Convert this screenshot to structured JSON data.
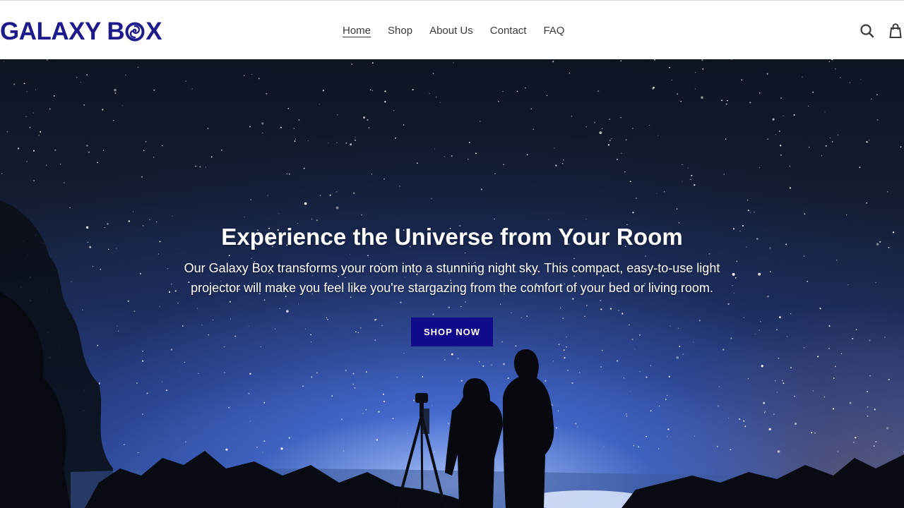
{
  "brand": {
    "logo_prefix": "GALAXY B",
    "logo_suffix": "X",
    "logo_color": "#1f1a8c"
  },
  "nav": {
    "items": [
      {
        "label": "Home",
        "active": true
      },
      {
        "label": "Shop",
        "active": false
      },
      {
        "label": "About Us",
        "active": false
      },
      {
        "label": "Contact",
        "active": false
      },
      {
        "label": "FAQ",
        "active": false
      }
    ]
  },
  "header_icons": [
    "search-icon",
    "cart-icon"
  ],
  "hero": {
    "title": "Experience the Universe from Your Room",
    "subtitle": "Our Galaxy Box transforms your room into a stunning night sky. This compact, easy-to-use light projector will make you feel like you're stargazing from the comfort of your bed or living room.",
    "cta_label": "SHOP NOW",
    "cta_color": "#110a8a"
  }
}
